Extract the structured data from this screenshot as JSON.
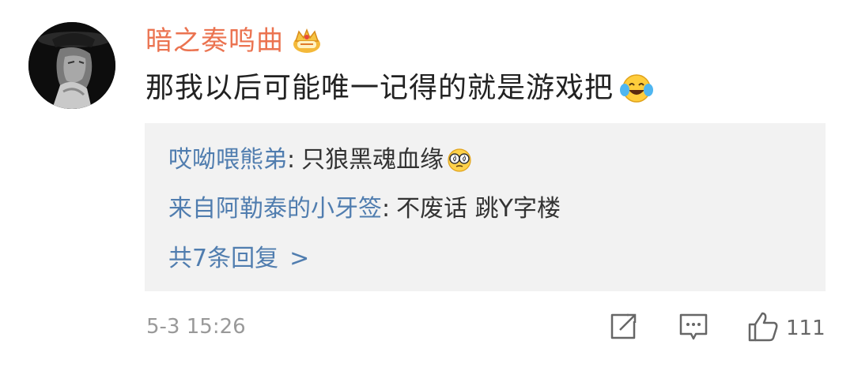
{
  "comment": {
    "username": "暗之奏鸣曲",
    "badge_icon": "crown-vip-icon",
    "text": "那我以后可能唯一记得的就是游戏把",
    "text_emoji": "laugh-cry-emoji",
    "replies": [
      {
        "author": "哎呦喂熊弟",
        "separator": ":",
        "content": "只狼黑魂血缘",
        "emoji": "dizzy-glasses-emoji"
      },
      {
        "author": "来自阿勒泰的小牙签",
        "separator": ":",
        "content": "不废话 跳Y字楼"
      }
    ],
    "more_replies_label": "共7条回复",
    "more_replies_chevron": ">",
    "timestamp": "5-3 15:26",
    "actions": {
      "share_icon": "share-icon",
      "comment_icon": "comment-icon",
      "like_icon": "thumbs-up-icon",
      "like_count": "111"
    }
  },
  "colors": {
    "username": "#eb7350",
    "link_blue": "#507daf",
    "reply_background": "#f2f2f2",
    "text_main": "#222222",
    "meta_gray": "#999999"
  }
}
